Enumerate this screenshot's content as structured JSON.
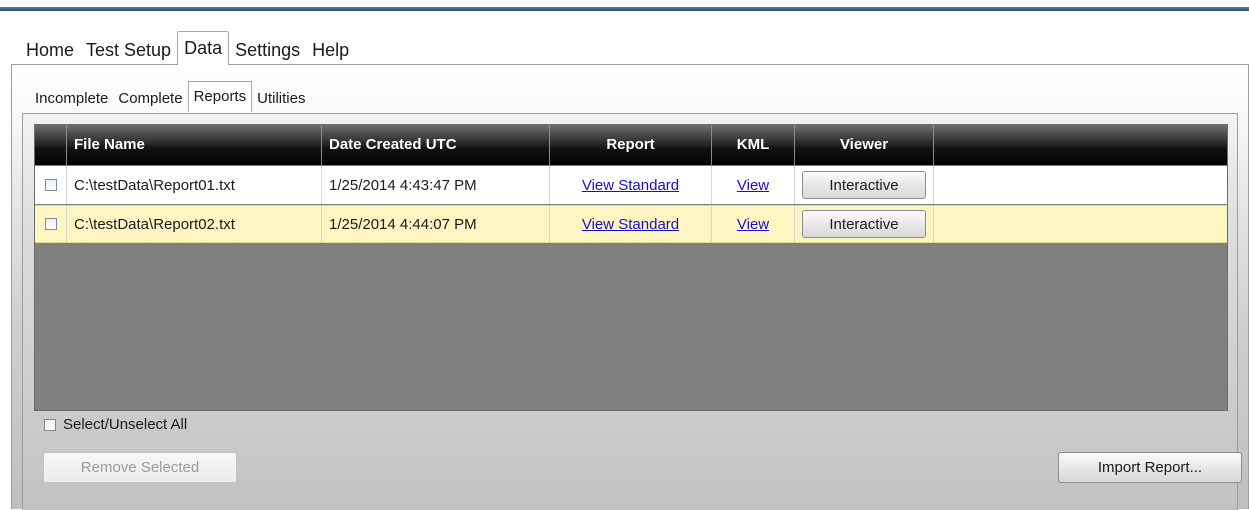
{
  "menu": {
    "tabs": [
      "Home",
      "Test Setup",
      "Data",
      "Settings",
      "Help"
    ],
    "active": "Data"
  },
  "subtabs": {
    "tabs": [
      "Incomplete",
      "Complete",
      "Reports",
      "Utilities"
    ],
    "active": "Reports"
  },
  "grid": {
    "columns": [
      "",
      "File Name",
      "Date Created UTC",
      "Report",
      "KML",
      "Viewer",
      ""
    ],
    "rows": [
      {
        "checked": false,
        "file_name": "C:\\testData\\Report01.txt",
        "date_created": "1/25/2014 4:43:47 PM",
        "report_link": "View Standard",
        "kml_link": "View",
        "viewer_button": "Interactive"
      },
      {
        "checked": false,
        "file_name": "C:\\testData\\Report02.txt",
        "date_created": "1/25/2014 4:44:07 PM",
        "report_link": "View Standard",
        "kml_link": "View",
        "viewer_button": "Interactive",
        "selected": true
      }
    ]
  },
  "footer": {
    "select_all_label": "Select/Unselect All",
    "remove_selected_label": "Remove Selected",
    "import_report_label": "Import Report..."
  },
  "colors": {
    "selected_row": "#fdf6c3",
    "grid_background": "#808080",
    "header_background": "#000000",
    "link": "#1a0dcc"
  }
}
